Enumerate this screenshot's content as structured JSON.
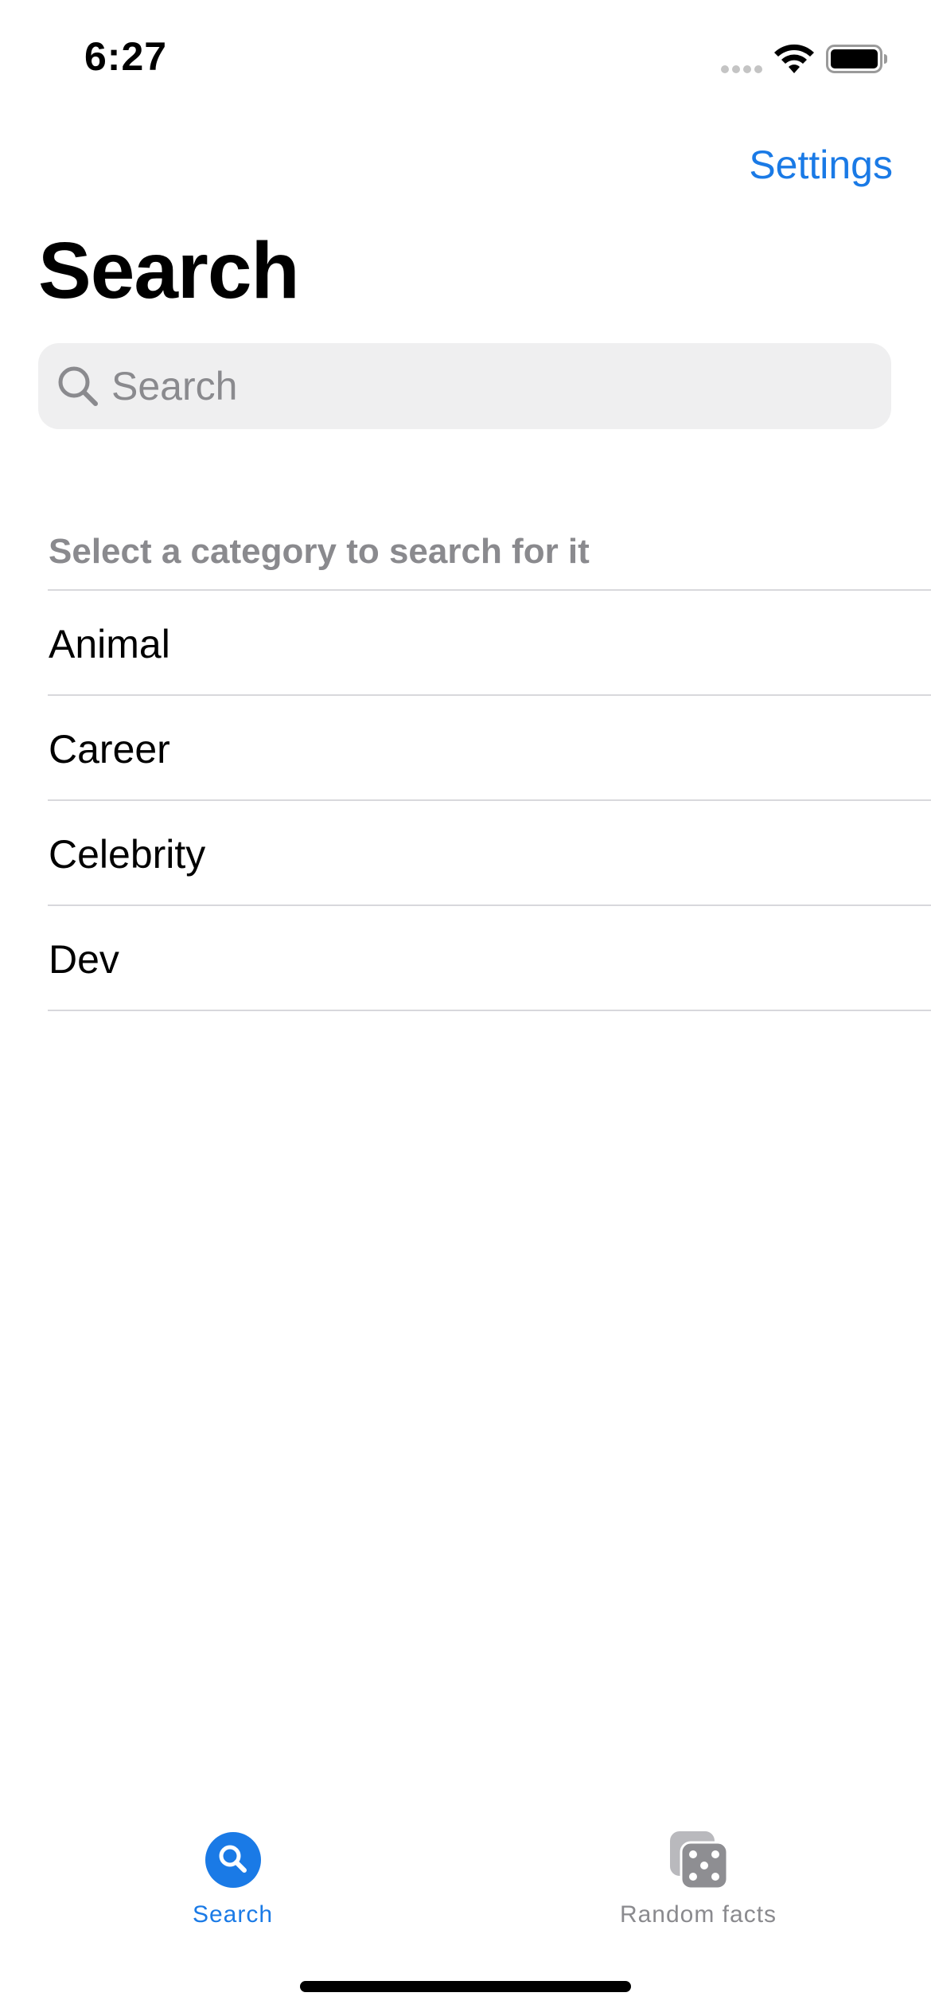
{
  "status_bar": {
    "time": "6:27"
  },
  "nav": {
    "settings_label": "Settings",
    "title": "Search"
  },
  "search": {
    "placeholder": "Search",
    "value": ""
  },
  "categories": {
    "header": "Select a category to search for it",
    "items": [
      {
        "label": "Animal"
      },
      {
        "label": "Career"
      },
      {
        "label": "Celebrity"
      },
      {
        "label": "Dev"
      }
    ]
  },
  "tab_bar": {
    "tabs": [
      {
        "label": "Search",
        "icon": "magnifying-glass-circle-icon",
        "selected": true
      },
      {
        "label": "Random facts",
        "icon": "dice-icon",
        "selected": false
      }
    ]
  },
  "colors": {
    "accent": "#1a7ae6",
    "secondary_text": "#8a8a8e",
    "search_field_bg": "#efeff0",
    "separator": "#d8d8dc"
  }
}
